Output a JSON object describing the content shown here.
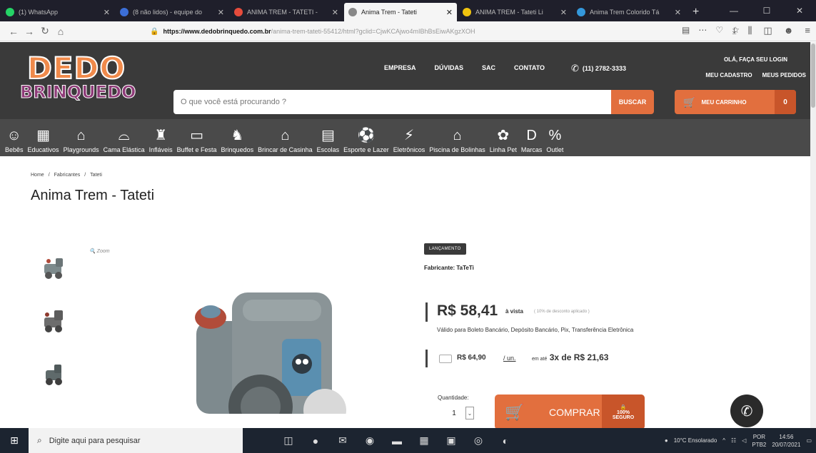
{
  "browser": {
    "tabs": [
      {
        "label": "(1) WhatsApp",
        "color": "#25d366",
        "active": false
      },
      {
        "label": "(8 não lidos) - equipe do",
        "color": "#3c6fd8",
        "active": false
      },
      {
        "label": "ANIMA TREM - TATETI -",
        "color": "#e74c3c",
        "active": false
      },
      {
        "label": "Anima Trem - Tateti",
        "color": "#888888",
        "active": true
      },
      {
        "label": "ANIMA TREM - Tateti Li",
        "color": "#f1c40f",
        "active": false
      },
      {
        "label": "Anima Trem Colorido Tá",
        "color": "#3498db",
        "active": false
      }
    ],
    "new_tab": "+",
    "url_domain": "https://www.dedobrinquedo.com.br",
    "url_rest": "/anima-trem-tateti-55412/html?gclid=CjwKCAjwo4mIBhBsEiwAKgzXOH"
  },
  "header": {
    "logo_top": "DEDO",
    "logo_bottom": "BRINQUEDO",
    "nav": [
      "EMPRESA",
      "DÚVIDAS",
      "SAC",
      "CONTATO"
    ],
    "phone": "(11) 2782-3333",
    "greeting": "OLÁ, FAÇA SEU LOGIN",
    "account_links": [
      "MEU CADASTRO",
      "MEUS PEDIDOS"
    ],
    "search_placeholder": "O que você está procurando ?",
    "search_button": "BUSCAR",
    "cart_label": "MEU CARRINHO",
    "cart_count": "0"
  },
  "categories": [
    {
      "label": "Bebês",
      "icon": "☺"
    },
    {
      "label": "Educativos",
      "icon": "▦"
    },
    {
      "label": "Playgrounds",
      "icon": "⌂"
    },
    {
      "label": "Cama Elástica",
      "icon": "⌓"
    },
    {
      "label": "Infláveis",
      "icon": "♜"
    },
    {
      "label": "Buffet e Festa",
      "icon": "▭"
    },
    {
      "label": "Brinquedos",
      "icon": "♞"
    },
    {
      "label": "Brincar de Casinha",
      "icon": "⌂"
    },
    {
      "label": "Escolas",
      "icon": "▤"
    },
    {
      "label": "Esporte e Lazer",
      "icon": "⚽"
    },
    {
      "label": "Eletrônicos",
      "icon": "⚡"
    },
    {
      "label": "Piscina de Bolinhas",
      "icon": "⌂"
    },
    {
      "label": "Linha Pet",
      "icon": "✿"
    },
    {
      "label": "Marcas",
      "icon": "D"
    },
    {
      "label": "Outlet",
      "icon": "%"
    }
  ],
  "breadcrumb": [
    "Home",
    "/",
    "Fabricantes",
    "/",
    "Tateti"
  ],
  "product": {
    "title": "Anima Trem - Tateti",
    "zoom": "Zoom",
    "badge": "LANÇAMENTO",
    "manufacturer": "Fabricante: TaTeTi",
    "price": "R$ 58,41",
    "price_suffix": "à vista",
    "discount_note": "( 10% de desconto aplicado )",
    "payment_note": "Válido para Boleto Bancário, Depósito Bancário, Pix, Transferência Eletrônica",
    "installment_price": "R$ 64,90",
    "installment_unit": "/ un.",
    "installment_prefix": "em até",
    "installment_text": "3x de R$ 21,63",
    "quantity_label": "Quantidade:",
    "quantity_value": "1",
    "buy_label": "COMPRAR",
    "secure_top": "100%",
    "secure_bottom": "SEGURO"
  },
  "taskbar": {
    "search_placeholder": "Digite aqui para pesquisar",
    "weather": "10°C Ensolarado",
    "lang_top": "POR",
    "lang_bottom": "PTB2",
    "time": "14:56",
    "date": "20/07/2021"
  },
  "colors": {
    "accent": "#e26f3e",
    "header_bg": "#3a3a3a",
    "cat_bg": "#4a4a4a"
  }
}
